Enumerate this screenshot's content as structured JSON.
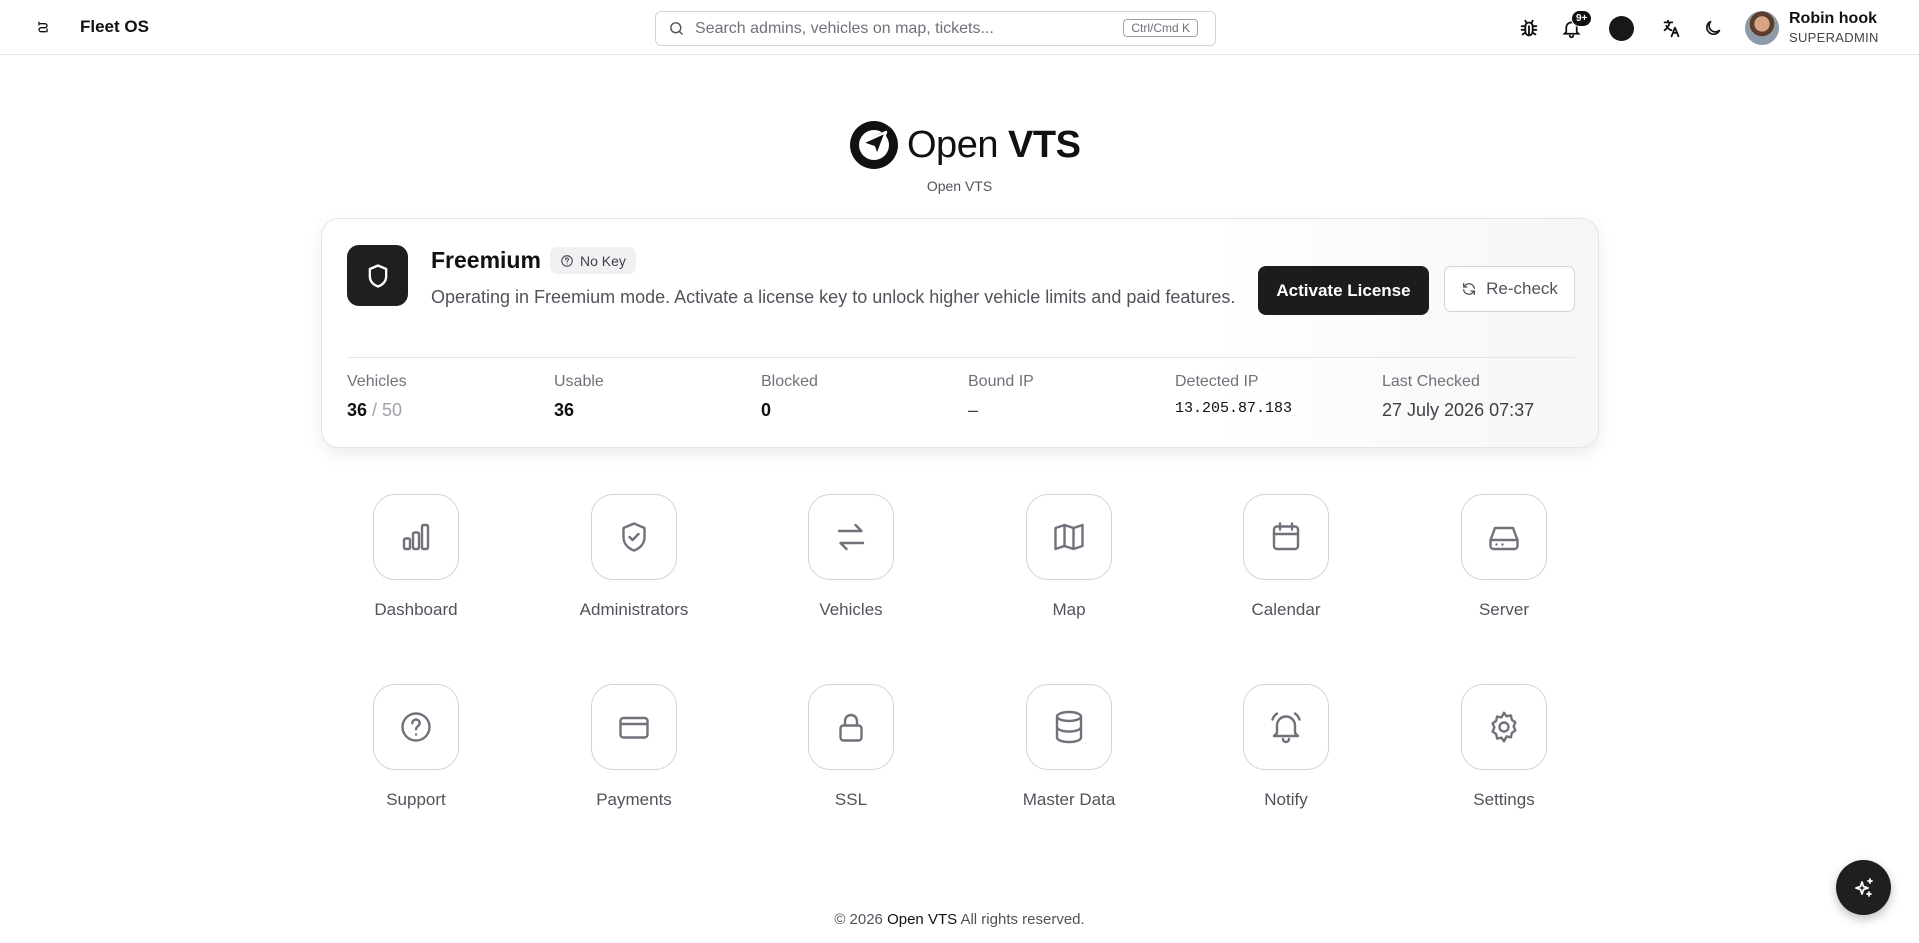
{
  "header": {
    "brand_name": "Fleet OS",
    "search_placeholder": "Search admins, vehicles on map, tickets...",
    "search_value": "",
    "search_shortcut": "Ctrl/Cmd K",
    "notifications_badge": "9+",
    "user": {
      "name": "Robin hook",
      "role": "SUPERADMIN"
    }
  },
  "logo": {
    "text_regular": "Open ",
    "text_bold": "VTS",
    "subtitle": "Open VTS"
  },
  "license": {
    "plan": "Freemium",
    "key_status": "No Key",
    "description": "Operating in Freemium mode. Activate a license key to unlock higher vehicle limits and paid features.",
    "activate_label": "Activate License",
    "recheck_label": "Re-check",
    "stats": {
      "vehicles_label": "Vehicles",
      "vehicles_used": "36",
      "vehicles_limit": "/ 50",
      "usable_label": "Usable",
      "usable_value": "36",
      "blocked_label": "Blocked",
      "blocked_value": "0",
      "bound_ip_label": "Bound IP",
      "bound_ip_value": "–",
      "detected_ip_label": "Detected IP",
      "detected_ip_value": "13.205.87.183",
      "last_checked_label": "Last Checked",
      "last_checked_value": "27 July 2026 07:37"
    }
  },
  "apps": [
    {
      "label": "Dashboard",
      "icon": "bar-chart-icon"
    },
    {
      "label": "Administrators",
      "icon": "shield-check-icon"
    },
    {
      "label": "Vehicles",
      "icon": "arrows-swap-icon"
    },
    {
      "label": "Map",
      "icon": "map-icon"
    },
    {
      "label": "Calendar",
      "icon": "calendar-icon"
    },
    {
      "label": "Server",
      "icon": "hard-drive-icon"
    },
    {
      "label": "Support",
      "icon": "help-circle-icon"
    },
    {
      "label": "Payments",
      "icon": "credit-card-icon"
    },
    {
      "label": "SSL",
      "icon": "lock-icon"
    },
    {
      "label": "Master Data",
      "icon": "database-icon"
    },
    {
      "label": "Notify",
      "icon": "bell-ring-icon"
    },
    {
      "label": "Settings",
      "icon": "gear-icon"
    }
  ],
  "footer": {
    "prefix": "© 2026 ",
    "brand": "Open VTS",
    "suffix": " All rights reserved."
  }
}
